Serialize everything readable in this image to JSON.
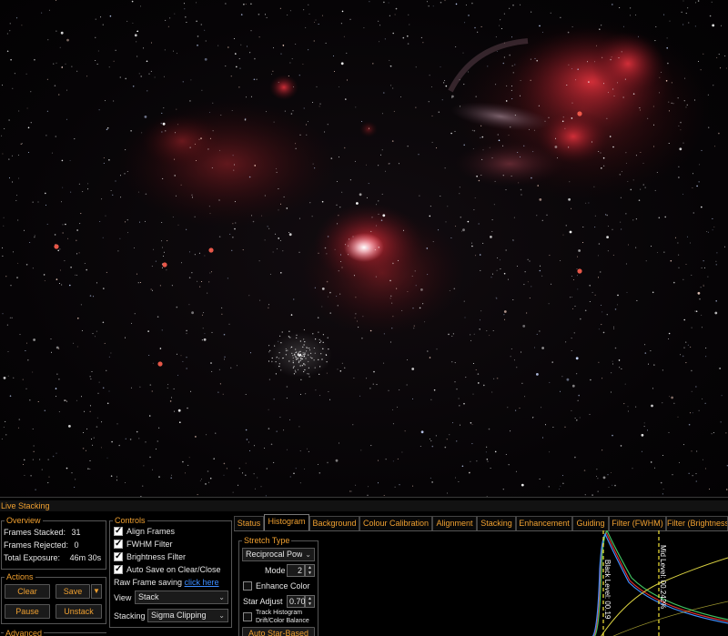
{
  "window": {
    "title": "Live Stacking"
  },
  "overview": {
    "legend": "Overview",
    "frames_stacked_label": "Frames Stacked:",
    "frames_stacked_value": "31",
    "frames_rejected_label": "Frames Rejected:",
    "frames_rejected_value": "0",
    "total_exposure_label": "Total Exposure:",
    "total_exposure_value": "46m 30s"
  },
  "actions": {
    "legend": "Actions",
    "clear": "Clear",
    "save": "Save",
    "pause": "Pause",
    "unstack": "Unstack"
  },
  "advanced": {
    "legend": "Advanced"
  },
  "controls": {
    "legend": "Controls",
    "align_frames": {
      "label": "Align Frames",
      "checked": true
    },
    "fwhm_filter": {
      "label": "FWHM Filter",
      "checked": true
    },
    "brightness_filter": {
      "label": "Brightness Filter",
      "checked": true
    },
    "auto_save": {
      "label": "Auto Save on Clear/Close",
      "checked": true
    },
    "raw_frame_label": "Raw Frame saving",
    "raw_frame_link": "click here",
    "view_label": "View",
    "view_value": "Stack",
    "stacking_label": "Stacking",
    "stacking_value": "Sigma Clipping"
  },
  "tabs": [
    {
      "label": "Status",
      "active": false
    },
    {
      "label": "Histogram",
      "active": true
    },
    {
      "label": "Background",
      "active": false
    },
    {
      "label": "Colour Calibration",
      "active": false
    },
    {
      "label": "Alignment",
      "active": false
    },
    {
      "label": "Stacking",
      "active": false
    },
    {
      "label": "Enhancement",
      "active": false
    },
    {
      "label": "Guiding",
      "active": false
    },
    {
      "label": "Filter (FWHM)",
      "active": false
    },
    {
      "label": "Filter (Brightness)",
      "active": false
    }
  ],
  "histogram": {
    "stretch_legend": "Stretch Type",
    "stretch_value": "Reciprocal Power",
    "mode_label": "Mode",
    "mode_value": "2",
    "enhance_color": {
      "label": "Enhance Color",
      "checked": false
    },
    "star_adjust_label": "Star Adjust",
    "star_adjust_value": "0.70",
    "track_label_1": "Track Histogram",
    "track_label_2": "Drift/Color Balance",
    "track_checked": false,
    "auto_button": "Auto Star-Based",
    "black_level_label": "Black Level: 00.19",
    "mid_level_label": "Mid Level: 00.242%",
    "marker_color": "#f5e63a",
    "curve_colors": {
      "red": "#e03030",
      "green": "#40c060",
      "blue": "#4090ff",
      "stretch": "#d8d040"
    }
  },
  "icons": {
    "dropdown": "chevron-down-icon",
    "spin": "spin-updown-icon",
    "check": "checkmark-icon"
  }
}
